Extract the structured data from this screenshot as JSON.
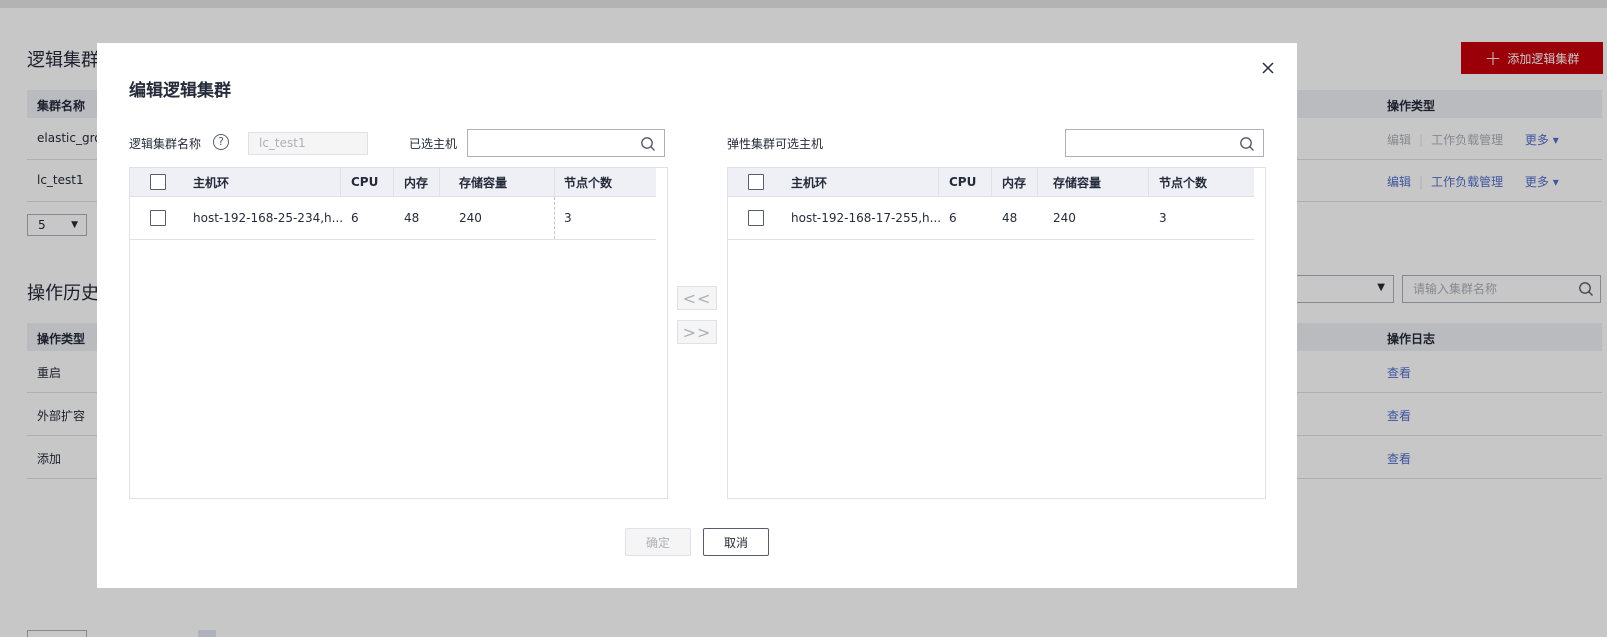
{
  "background": {
    "section1_title": "逻辑集群",
    "add_button_label": "添加逻辑集群",
    "table1": {
      "headers": [
        "集群名称",
        "操作类型"
      ],
      "rows": [
        {
          "name": "elastic_gro",
          "actions": [
            "编辑",
            "工作负载管理",
            "更多"
          ],
          "actions_enabled": false
        },
        {
          "name": "lc_test1",
          "actions": [
            "编辑",
            "工作负载管理",
            "更多"
          ],
          "actions_enabled": true
        }
      ]
    },
    "page_size": "5",
    "section2_title": "操作历史",
    "search_placeholder": "请输入集群名称",
    "table2": {
      "headers": [
        "操作类型",
        "操作日志"
      ],
      "rows": [
        {
          "type": "重启",
          "log": "查看"
        },
        {
          "type": "外部扩容",
          "log": "查看"
        },
        {
          "type": "添加",
          "log": "查看"
        }
      ]
    }
  },
  "modal": {
    "title": "编辑逻辑集群",
    "cluster_name_label": "逻辑集群名称",
    "help_icon": "?",
    "cluster_name_value": "lc_test1",
    "selected_hosts_label": "已选主机",
    "available_hosts_label": "弹性集群可选主机",
    "columns": [
      "主机环",
      "CPU",
      "内存",
      "存储容量",
      "节点个数"
    ],
    "left_rows": [
      {
        "host": "host-192-168-25-234,h...",
        "cpu": "6",
        "memory": "48",
        "storage": "240",
        "nodes": "3"
      }
    ],
    "right_rows": [
      {
        "host": "host-192-168-17-255,h...",
        "cpu": "6",
        "memory": "48",
        "storage": "240",
        "nodes": "3"
      }
    ],
    "move_left_label": "<<",
    "move_right_label": ">>",
    "confirm_label": "确定",
    "cancel_label": "取消"
  }
}
